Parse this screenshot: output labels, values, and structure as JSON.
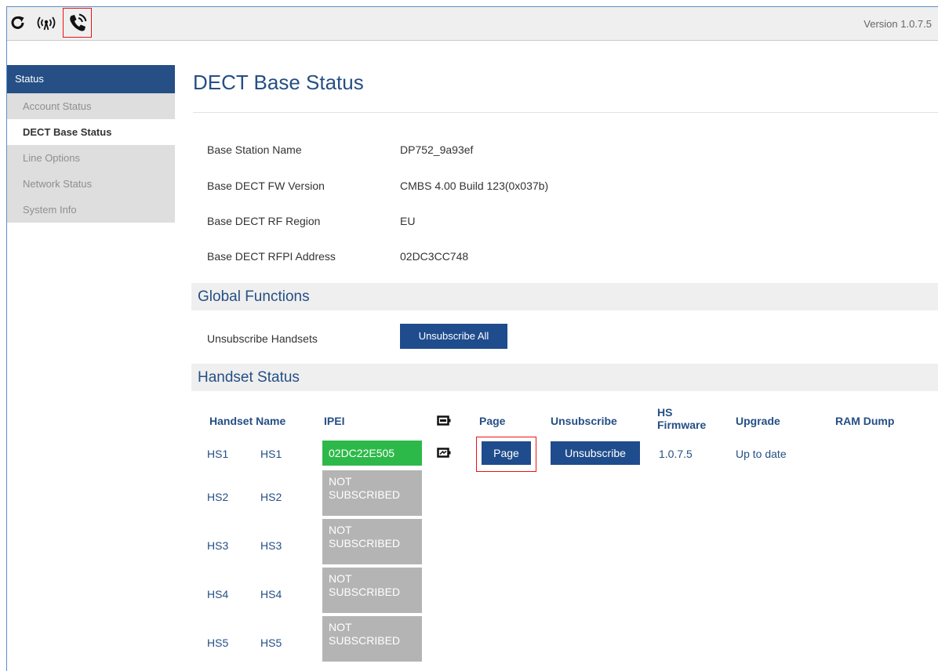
{
  "topbar": {
    "icons": [
      "refresh-icon",
      "wireless-icon",
      "phone-ring-icon"
    ],
    "version": "Version 1.0.7.5"
  },
  "sidebar": {
    "header": "Status",
    "items": [
      {
        "label": "Account Status"
      },
      {
        "label": "DECT Base Status"
      },
      {
        "label": "Line Options"
      },
      {
        "label": "Network Status"
      },
      {
        "label": "System Info"
      }
    ]
  },
  "main": {
    "title": "DECT Base Status",
    "info": [
      {
        "label": "Base Station Name",
        "value": "DP752_9a93ef"
      },
      {
        "label": "Base DECT FW Version",
        "value": "CMBS 4.00 Build 123(0x037b)"
      },
      {
        "label": "Base DECT RF Region",
        "value": "EU"
      },
      {
        "label": "Base DECT RFPI Address",
        "value": "02DC3CC748"
      }
    ],
    "global": {
      "heading": "Global Functions",
      "label": "Unsubscribe Handsets",
      "button": "Unsubscribe All"
    },
    "handsets": {
      "heading": "Handset Status",
      "columns": {
        "name": "Handset Name",
        "ipei": "IPEI",
        "page": "Page",
        "unsubscribe": "Unsubscribe",
        "firmware": "HS Firmware",
        "upgrade": "Upgrade",
        "ramdump": "RAM Dump"
      },
      "rows": [
        {
          "id": "HS1",
          "name": "HS1",
          "ipei": "02DC22E505",
          "page_button": "Page",
          "unsubscribe_button": "Unsubscribe",
          "firmware": "1.0.7.5",
          "upgrade": "Up to date"
        },
        {
          "id": "HS2",
          "name": "HS2",
          "ipei": "NOT SUBSCRIBED"
        },
        {
          "id": "HS3",
          "name": "HS3",
          "ipei": "NOT SUBSCRIBED"
        },
        {
          "id": "HS4",
          "name": "HS4",
          "ipei": "NOT SUBSCRIBED"
        },
        {
          "id": "HS5",
          "name": "HS5",
          "ipei": "NOT SUBSCRIBED"
        }
      ]
    }
  },
  "colors": {
    "brand": "#254f85",
    "button": "#1f4c8c",
    "subscribed": "#2db94a",
    "not_subscribed": "#b4b4b4",
    "highlight": "#ee1111"
  }
}
